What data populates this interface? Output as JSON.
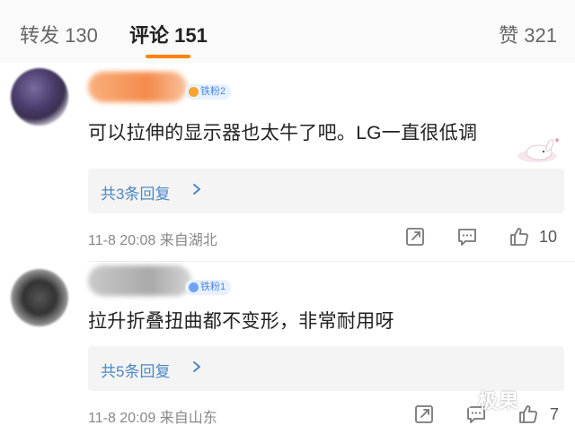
{
  "tabs": {
    "repost": "转发 130",
    "comments": "评论 151",
    "likes": "赞 321"
  },
  "comments": [
    {
      "badge": "铁粉2",
      "text": "可以拉伸的显示器也太牛了吧。LG一直很低调",
      "replies": "共3条回复",
      "meta": "11-8 20:08  来自湖北",
      "likes": "10"
    },
    {
      "badge": "铁粉1",
      "text": "拉升折叠扭曲都不变形，非常耐用呀",
      "replies": "共5条回复",
      "meta": "11-8 20:09  来自山东",
      "likes": "7"
    }
  ],
  "watermark": "极果",
  "colors": {
    "accent": "#ff8200",
    "link": "#4a88c8",
    "badge_bg": "#e8f1ff",
    "badge_text": "#4a88e8"
  }
}
